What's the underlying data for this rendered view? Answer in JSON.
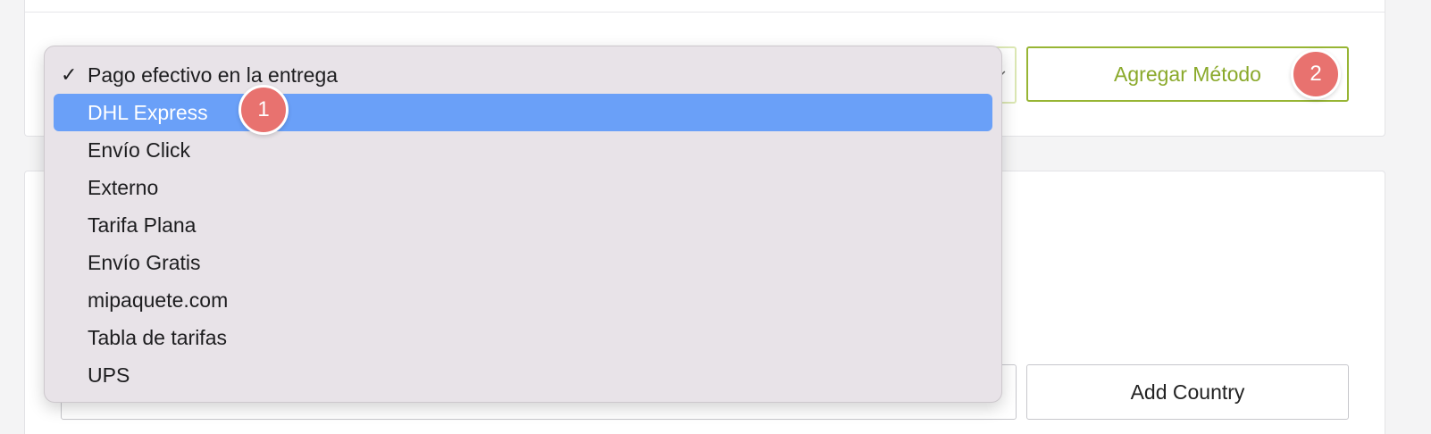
{
  "shipping_method": {
    "selected": "Pago efectivo en la entrega",
    "options": [
      "Pago efectivo en la entrega",
      "DHL Express",
      "Envío Click",
      "Externo",
      "Tarifa Plana",
      "Envío Gratis",
      "mipaquete.com",
      "Tabla de tarifas",
      "UPS"
    ],
    "highlighted": "DHL Express",
    "add_button_label": "Agregar Método"
  },
  "countries": {
    "add_button_label": "Add Country"
  },
  "annotations": {
    "badge_1": "1",
    "badge_2": "2"
  },
  "colors": {
    "accent_green": "#8aa92b",
    "highlight_blue": "#6aa0f8",
    "badge_red": "#e8726f"
  }
}
